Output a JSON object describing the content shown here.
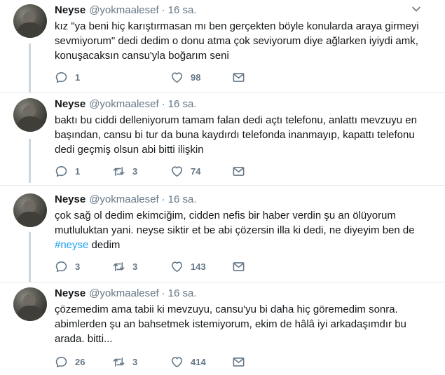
{
  "colors": {
    "text": "#14171a",
    "muted": "#657786",
    "link": "#1da1f2",
    "thread_line": "#ccd6dd",
    "border": "#e6ecf0"
  },
  "tweets": [
    {
      "name": "Neyse",
      "handle": "@yokmaalesef",
      "time": "16 sa.",
      "separator": "·",
      "text": "kız \"ya beni hiç karıştırmasan mı ben gerçekten böyle konularda araya  girmeyi\nsevmiyorum\" dedi dedim o donu atma çok seviyorum diye ağlarken  iyiydi amk,\nkonuşacaksın cansu'yla boğarım seni",
      "replies": "1",
      "retweets": "",
      "likes": "98"
    },
    {
      "name": "Neyse",
      "handle": "@yokmaalesef",
      "time": "16 sa.",
      "separator": "·",
      "text": "baktı bu ciddi delleniyorum tamam falan dedi açtı telefonu, anlattı  mevzuyu en\nbaşından, cansu bi tur da buna kaydırdı telefonda inanmayıp,  kapattı telefonu\ndedi geçmiş olsun abi bitti ilişkin",
      "replies": "1",
      "retweets": "3",
      "likes": "74"
    },
    {
      "name": "Neyse",
      "handle": "@yokmaalesef",
      "time": "16 sa.",
      "separator": "·",
      "text_before": "çok sağ ol dedim ekimciğim, cidden nefis bir haber verdin şu an ölüyorum\nmutluluktan yani. neyse siktir et be abi çözersin illa ki dedi, ne  diyeyim ben de\n",
      "hashtag": "#neyse",
      "text_after": " dedim",
      "replies": "3",
      "retweets": "3",
      "likes": "143"
    },
    {
      "name": "Neyse",
      "handle": "@yokmaalesef",
      "time": "16 sa.",
      "separator": "·",
      "text": "çözemedim ama tabii ki mevzuyu, cansu'yu bi daha hiç göremedim sonra.\nabimlerden şu an bahsetmek istemiyorum, ekim de hâlâ iyi arkadaşımdır bu\narada. bitti...",
      "replies": "26",
      "retweets": "3",
      "likes": "414"
    }
  ],
  "icons": {
    "reply": "reply-icon",
    "retweet": "retweet-icon",
    "like": "heart-icon",
    "dm": "envelope-icon",
    "more": "chevron-down-icon"
  }
}
